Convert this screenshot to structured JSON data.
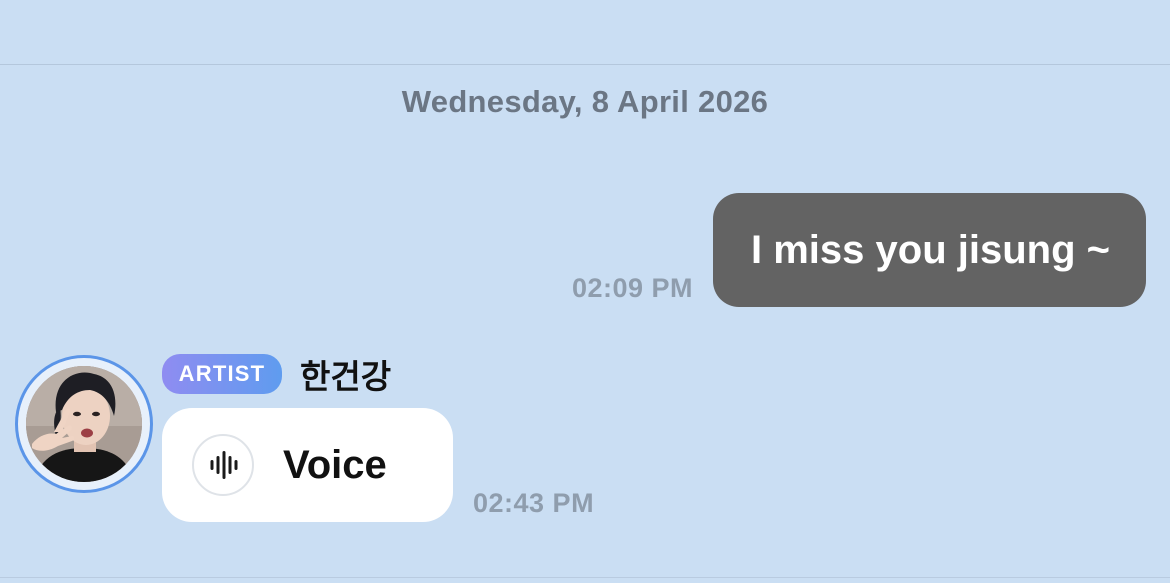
{
  "date_separator": "Wednesday, 8 April 2026",
  "messages": [
    {
      "direction": "outgoing",
      "text": "I miss you jisung ~",
      "time": "02:09 PM"
    },
    {
      "direction": "incoming",
      "sender_badge": "ARTIST",
      "sender_name": "한건강",
      "type": "voice",
      "label": "Voice",
      "time": "02:43 PM"
    }
  ],
  "colors": {
    "background": "#cadef3",
    "outgoing_bubble": "#636363",
    "incoming_bubble": "#ffffff",
    "badge_gradient_start": "#8f8cf1",
    "badge_gradient_end": "#5f9cef",
    "timestamp": "#8f9dad"
  },
  "icons": {
    "voice": "waveform-icon"
  }
}
